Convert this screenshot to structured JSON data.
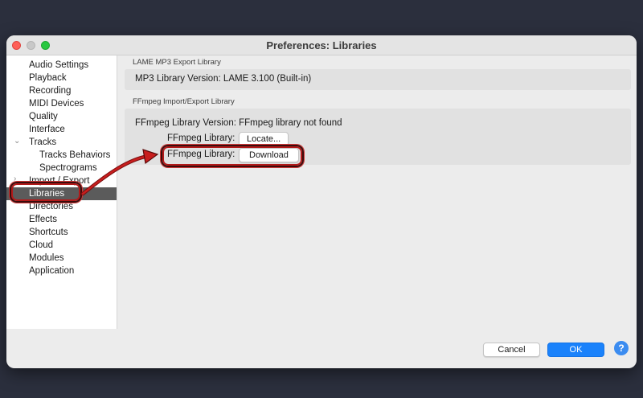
{
  "window": {
    "title": "Preferences: Libraries"
  },
  "sidebar": {
    "items": [
      {
        "label": "Audio Settings"
      },
      {
        "label": "Playback"
      },
      {
        "label": "Recording"
      },
      {
        "label": "MIDI Devices"
      },
      {
        "label": "Quality"
      },
      {
        "label": "Interface"
      },
      {
        "label": "Tracks"
      },
      {
        "label": "Tracks Behaviors"
      },
      {
        "label": "Spectrograms"
      },
      {
        "label": "Import / Export"
      },
      {
        "label": "Libraries"
      },
      {
        "label": "Directories"
      },
      {
        "label": "Effects"
      },
      {
        "label": "Shortcuts"
      },
      {
        "label": "Cloud"
      },
      {
        "label": "Modules"
      },
      {
        "label": "Application"
      }
    ],
    "selected": "Libraries"
  },
  "lame": {
    "section_label": "LAME MP3 Export Library",
    "version_text": "MP3 Library Version: LAME 3.100 (Built-in)"
  },
  "ffmpeg": {
    "section_label": "FFmpeg Import/Export Library",
    "version_text": "FFmpeg Library Version: FFmpeg library not found",
    "locate_label": "FFmpeg Library:",
    "locate_button": "Locate...",
    "download_label": "FFmpeg Library:",
    "download_button": "Download"
  },
  "footer": {
    "cancel_label": "Cancel",
    "ok_label": "OK",
    "help_label": "?"
  },
  "colors": {
    "background": "#2b2f3d",
    "accent": "#1a82fb",
    "selected_item": "#5b5b5b",
    "annotation": "#b21a1a"
  }
}
